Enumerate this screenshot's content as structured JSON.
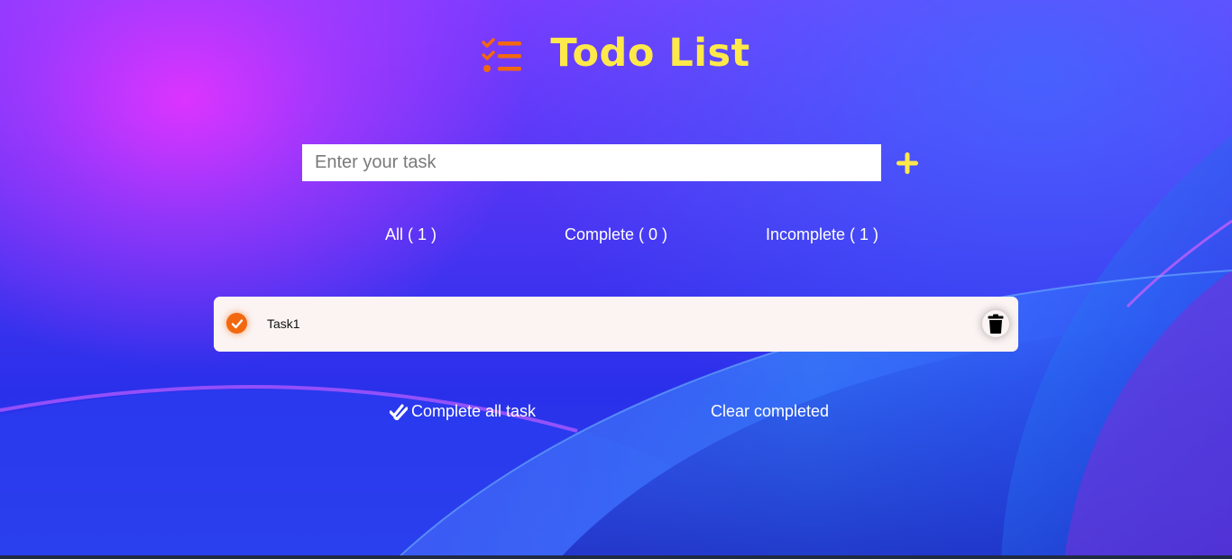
{
  "header": {
    "title": "Todo List",
    "icon": "checklist-icon",
    "title_color": "#ffe94a",
    "icon_color": "#f2680f"
  },
  "input": {
    "placeholder": "Enter your task",
    "value": "",
    "add_icon": "plus-icon"
  },
  "tabs": [
    {
      "label": "All ( 1 )"
    },
    {
      "label": "Complete ( 0 )"
    },
    {
      "label": "Incomplete ( 1 )"
    }
  ],
  "tasks": [
    {
      "text": "Task1",
      "check_icon": "check-circle-icon",
      "delete_icon": "trash-icon"
    }
  ],
  "footer": {
    "complete_all_label": "Complete all task",
    "complete_all_icon": "double-check-icon",
    "clear_completed_label": "Clear completed"
  }
}
